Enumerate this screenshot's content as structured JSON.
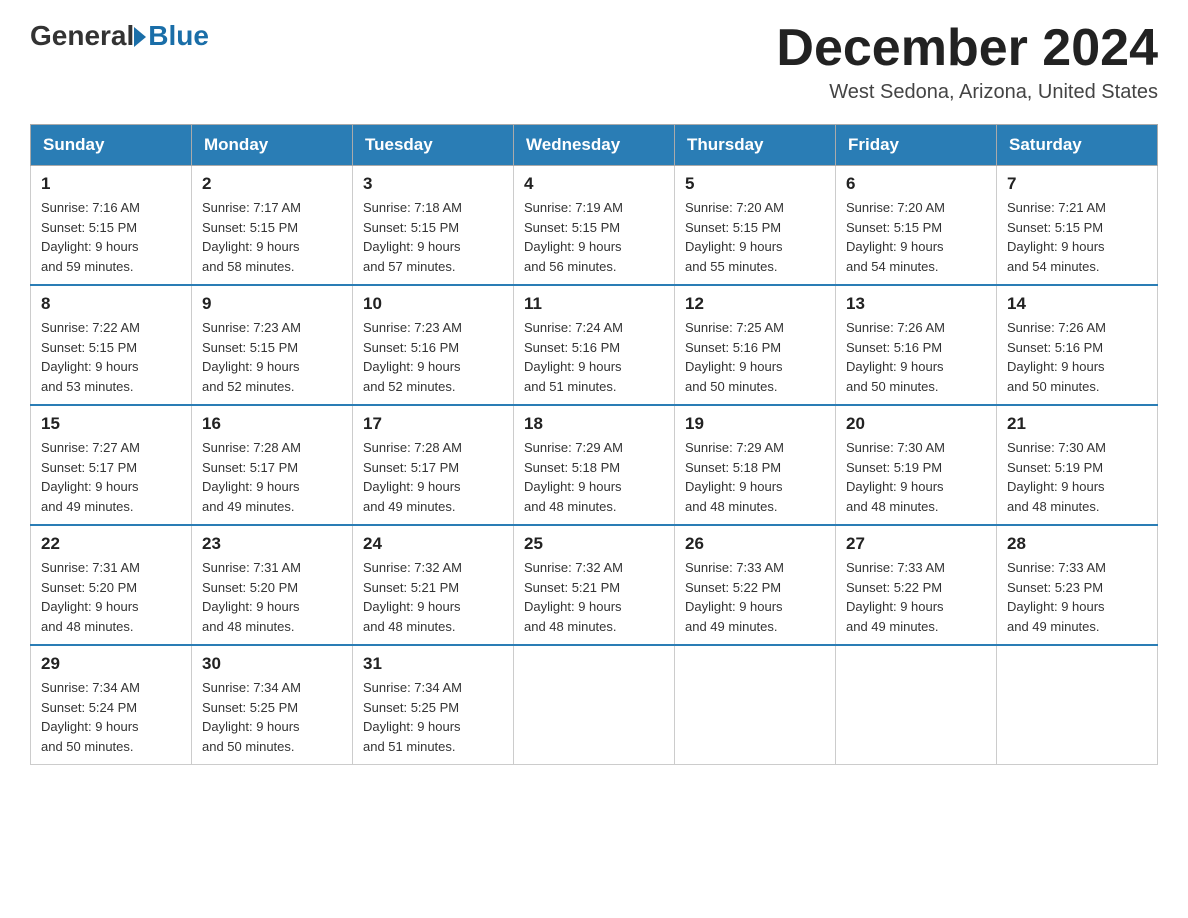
{
  "header": {
    "logo_general": "General",
    "logo_blue": "Blue",
    "month_title": "December 2024",
    "location": "West Sedona, Arizona, United States"
  },
  "days_of_week": [
    "Sunday",
    "Monday",
    "Tuesday",
    "Wednesday",
    "Thursday",
    "Friday",
    "Saturday"
  ],
  "weeks": [
    [
      {
        "day": "1",
        "sunrise": "7:16 AM",
        "sunset": "5:15 PM",
        "daylight": "9 hours and 59 minutes."
      },
      {
        "day": "2",
        "sunrise": "7:17 AM",
        "sunset": "5:15 PM",
        "daylight": "9 hours and 58 minutes."
      },
      {
        "day": "3",
        "sunrise": "7:18 AM",
        "sunset": "5:15 PM",
        "daylight": "9 hours and 57 minutes."
      },
      {
        "day": "4",
        "sunrise": "7:19 AM",
        "sunset": "5:15 PM",
        "daylight": "9 hours and 56 minutes."
      },
      {
        "day": "5",
        "sunrise": "7:20 AM",
        "sunset": "5:15 PM",
        "daylight": "9 hours and 55 minutes."
      },
      {
        "day": "6",
        "sunrise": "7:20 AM",
        "sunset": "5:15 PM",
        "daylight": "9 hours and 54 minutes."
      },
      {
        "day": "7",
        "sunrise": "7:21 AM",
        "sunset": "5:15 PM",
        "daylight": "9 hours and 54 minutes."
      }
    ],
    [
      {
        "day": "8",
        "sunrise": "7:22 AM",
        "sunset": "5:15 PM",
        "daylight": "9 hours and 53 minutes."
      },
      {
        "day": "9",
        "sunrise": "7:23 AM",
        "sunset": "5:15 PM",
        "daylight": "9 hours and 52 minutes."
      },
      {
        "day": "10",
        "sunrise": "7:23 AM",
        "sunset": "5:16 PM",
        "daylight": "9 hours and 52 minutes."
      },
      {
        "day": "11",
        "sunrise": "7:24 AM",
        "sunset": "5:16 PM",
        "daylight": "9 hours and 51 minutes."
      },
      {
        "day": "12",
        "sunrise": "7:25 AM",
        "sunset": "5:16 PM",
        "daylight": "9 hours and 50 minutes."
      },
      {
        "day": "13",
        "sunrise": "7:26 AM",
        "sunset": "5:16 PM",
        "daylight": "9 hours and 50 minutes."
      },
      {
        "day": "14",
        "sunrise": "7:26 AM",
        "sunset": "5:16 PM",
        "daylight": "9 hours and 50 minutes."
      }
    ],
    [
      {
        "day": "15",
        "sunrise": "7:27 AM",
        "sunset": "5:17 PM",
        "daylight": "9 hours and 49 minutes."
      },
      {
        "day": "16",
        "sunrise": "7:28 AM",
        "sunset": "5:17 PM",
        "daylight": "9 hours and 49 minutes."
      },
      {
        "day": "17",
        "sunrise": "7:28 AM",
        "sunset": "5:17 PM",
        "daylight": "9 hours and 49 minutes."
      },
      {
        "day": "18",
        "sunrise": "7:29 AM",
        "sunset": "5:18 PM",
        "daylight": "9 hours and 48 minutes."
      },
      {
        "day": "19",
        "sunrise": "7:29 AM",
        "sunset": "5:18 PM",
        "daylight": "9 hours and 48 minutes."
      },
      {
        "day": "20",
        "sunrise": "7:30 AM",
        "sunset": "5:19 PM",
        "daylight": "9 hours and 48 minutes."
      },
      {
        "day": "21",
        "sunrise": "7:30 AM",
        "sunset": "5:19 PM",
        "daylight": "9 hours and 48 minutes."
      }
    ],
    [
      {
        "day": "22",
        "sunrise": "7:31 AM",
        "sunset": "5:20 PM",
        "daylight": "9 hours and 48 minutes."
      },
      {
        "day": "23",
        "sunrise": "7:31 AM",
        "sunset": "5:20 PM",
        "daylight": "9 hours and 48 minutes."
      },
      {
        "day": "24",
        "sunrise": "7:32 AM",
        "sunset": "5:21 PM",
        "daylight": "9 hours and 48 minutes."
      },
      {
        "day": "25",
        "sunrise": "7:32 AM",
        "sunset": "5:21 PM",
        "daylight": "9 hours and 48 minutes."
      },
      {
        "day": "26",
        "sunrise": "7:33 AM",
        "sunset": "5:22 PM",
        "daylight": "9 hours and 49 minutes."
      },
      {
        "day": "27",
        "sunrise": "7:33 AM",
        "sunset": "5:22 PM",
        "daylight": "9 hours and 49 minutes."
      },
      {
        "day": "28",
        "sunrise": "7:33 AM",
        "sunset": "5:23 PM",
        "daylight": "9 hours and 49 minutes."
      }
    ],
    [
      {
        "day": "29",
        "sunrise": "7:34 AM",
        "sunset": "5:24 PM",
        "daylight": "9 hours and 50 minutes."
      },
      {
        "day": "30",
        "sunrise": "7:34 AM",
        "sunset": "5:25 PM",
        "daylight": "9 hours and 50 minutes."
      },
      {
        "day": "31",
        "sunrise": "7:34 AM",
        "sunset": "5:25 PM",
        "daylight": "9 hours and 51 minutes."
      },
      null,
      null,
      null,
      null
    ]
  ],
  "labels": {
    "sunrise": "Sunrise:",
    "sunset": "Sunset:",
    "daylight": "Daylight:"
  }
}
